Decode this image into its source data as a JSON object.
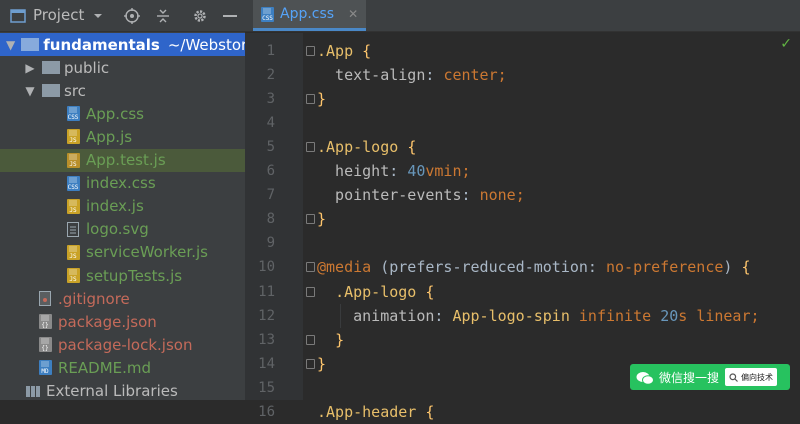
{
  "project_panel": {
    "title": "Project",
    "toolbar_icons": [
      "project-window-icon",
      "chevron-down-icon",
      "locate-icon",
      "collapse-icon",
      "gear-icon",
      "minimize-icon"
    ],
    "tree": [
      {
        "label": "fundamentals",
        "suffix": "~/Webstorm",
        "kind": "folder-root",
        "expanded": true,
        "depth": 0,
        "state": "selected"
      },
      {
        "label": "public",
        "kind": "folder",
        "expanded": false,
        "depth": 1
      },
      {
        "label": "src",
        "kind": "folder",
        "expanded": true,
        "depth": 1
      },
      {
        "label": "App.css",
        "kind": "css",
        "depth": 2
      },
      {
        "label": "App.js",
        "kind": "js",
        "depth": 2
      },
      {
        "label": "App.test.js",
        "kind": "test",
        "depth": 2,
        "state": "highlighted"
      },
      {
        "label": "index.css",
        "kind": "css",
        "depth": 2
      },
      {
        "label": "index.js",
        "kind": "js",
        "depth": 2
      },
      {
        "label": "logo.svg",
        "kind": "svg",
        "depth": 2
      },
      {
        "label": "serviceWorker.js",
        "kind": "js",
        "depth": 2
      },
      {
        "label": "setupTests.js",
        "kind": "js",
        "depth": 2
      },
      {
        "label": ".gitignore",
        "kind": "git",
        "depth": 1
      },
      {
        "label": "package.json",
        "kind": "json",
        "depth": 1
      },
      {
        "label": "package-lock.json",
        "kind": "json",
        "depth": 1
      },
      {
        "label": "README.md",
        "kind": "md",
        "depth": 1
      },
      {
        "label": "External Libraries",
        "kind": "libs",
        "depth": 0
      }
    ]
  },
  "editor": {
    "tab": {
      "label": "App.css",
      "icon": "css-file-icon",
      "badge": "CSS",
      "close": "✕"
    },
    "status_icon": "check-icon",
    "status_symbol": "✓",
    "lines": [
      {
        "n": "1",
        "tokens": [
          {
            "t": ".App",
            "c": "sel-c"
          },
          {
            "t": " "
          },
          {
            "t": "{",
            "c": "br"
          }
        ]
      },
      {
        "n": "2",
        "tokens": [
          {
            "t": "  text-align",
            "c": "prop"
          },
          {
            "t": ": "
          },
          {
            "t": "center",
            "c": "val"
          },
          {
            "t": ";",
            "c": "val"
          }
        ]
      },
      {
        "n": "3",
        "tokens": [
          {
            "t": "}",
            "c": "br"
          }
        ]
      },
      {
        "n": "4",
        "tokens": []
      },
      {
        "n": "5",
        "tokens": [
          {
            "t": ".App-logo",
            "c": "sel-c"
          },
          {
            "t": " "
          },
          {
            "t": "{",
            "c": "br"
          }
        ]
      },
      {
        "n": "6",
        "tokens": [
          {
            "t": "  height",
            "c": "prop"
          },
          {
            "t": ": "
          },
          {
            "t": "40",
            "c": "num"
          },
          {
            "t": "vmin",
            "c": "val"
          },
          {
            "t": ";",
            "c": "val"
          }
        ]
      },
      {
        "n": "7",
        "tokens": [
          {
            "t": "  pointer-events",
            "c": "prop"
          },
          {
            "t": ": "
          },
          {
            "t": "none",
            "c": "val"
          },
          {
            "t": ";",
            "c": "val"
          }
        ]
      },
      {
        "n": "8",
        "tokens": [
          {
            "t": "}",
            "c": "br"
          }
        ]
      },
      {
        "n": "9",
        "tokens": []
      },
      {
        "n": "10",
        "tokens": [
          {
            "t": "@media",
            "c": "kw"
          },
          {
            "t": " (prefers-reduced-motion: "
          },
          {
            "t": "no-preference",
            "c": "val"
          },
          {
            "t": ") "
          },
          {
            "t": "{",
            "c": "br"
          }
        ]
      },
      {
        "n": "11",
        "tokens": [
          {
            "t": "  "
          },
          {
            "t": ".App-logo",
            "c": "sel-c"
          },
          {
            "t": " "
          },
          {
            "t": "{",
            "c": "br"
          }
        ]
      },
      {
        "n": "12",
        "tokens": [
          {
            "t": "    animation",
            "c": "prop"
          },
          {
            "t": ": "
          },
          {
            "t": "App-logo-spin",
            "c": "sel-c"
          },
          {
            "t": " "
          },
          {
            "t": "infinite",
            "c": "val"
          },
          {
            "t": " "
          },
          {
            "t": "20",
            "c": "num"
          },
          {
            "t": "s",
            "c": "val"
          },
          {
            "t": " "
          },
          {
            "t": "linear",
            "c": "val"
          },
          {
            "t": ";",
            "c": "val"
          }
        ]
      },
      {
        "n": "13",
        "tokens": [
          {
            "t": "  "
          },
          {
            "t": "}",
            "c": "br"
          }
        ]
      },
      {
        "n": "14",
        "tokens": [
          {
            "t": "}",
            "c": "br"
          }
        ]
      },
      {
        "n": "15",
        "tokens": []
      },
      {
        "n": "16",
        "tokens": [
          {
            "t": ".App-header",
            "c": "sel-c"
          },
          {
            "t": " "
          },
          {
            "t": "{",
            "c": "br"
          }
        ]
      }
    ]
  },
  "watermark": {
    "label": "微信搜一搜",
    "search_text": "偏向技术"
  },
  "colors": {
    "accent": "#2f65ca",
    "tab_underline": "#4a88c7",
    "wechat_green": "#27c25f"
  }
}
